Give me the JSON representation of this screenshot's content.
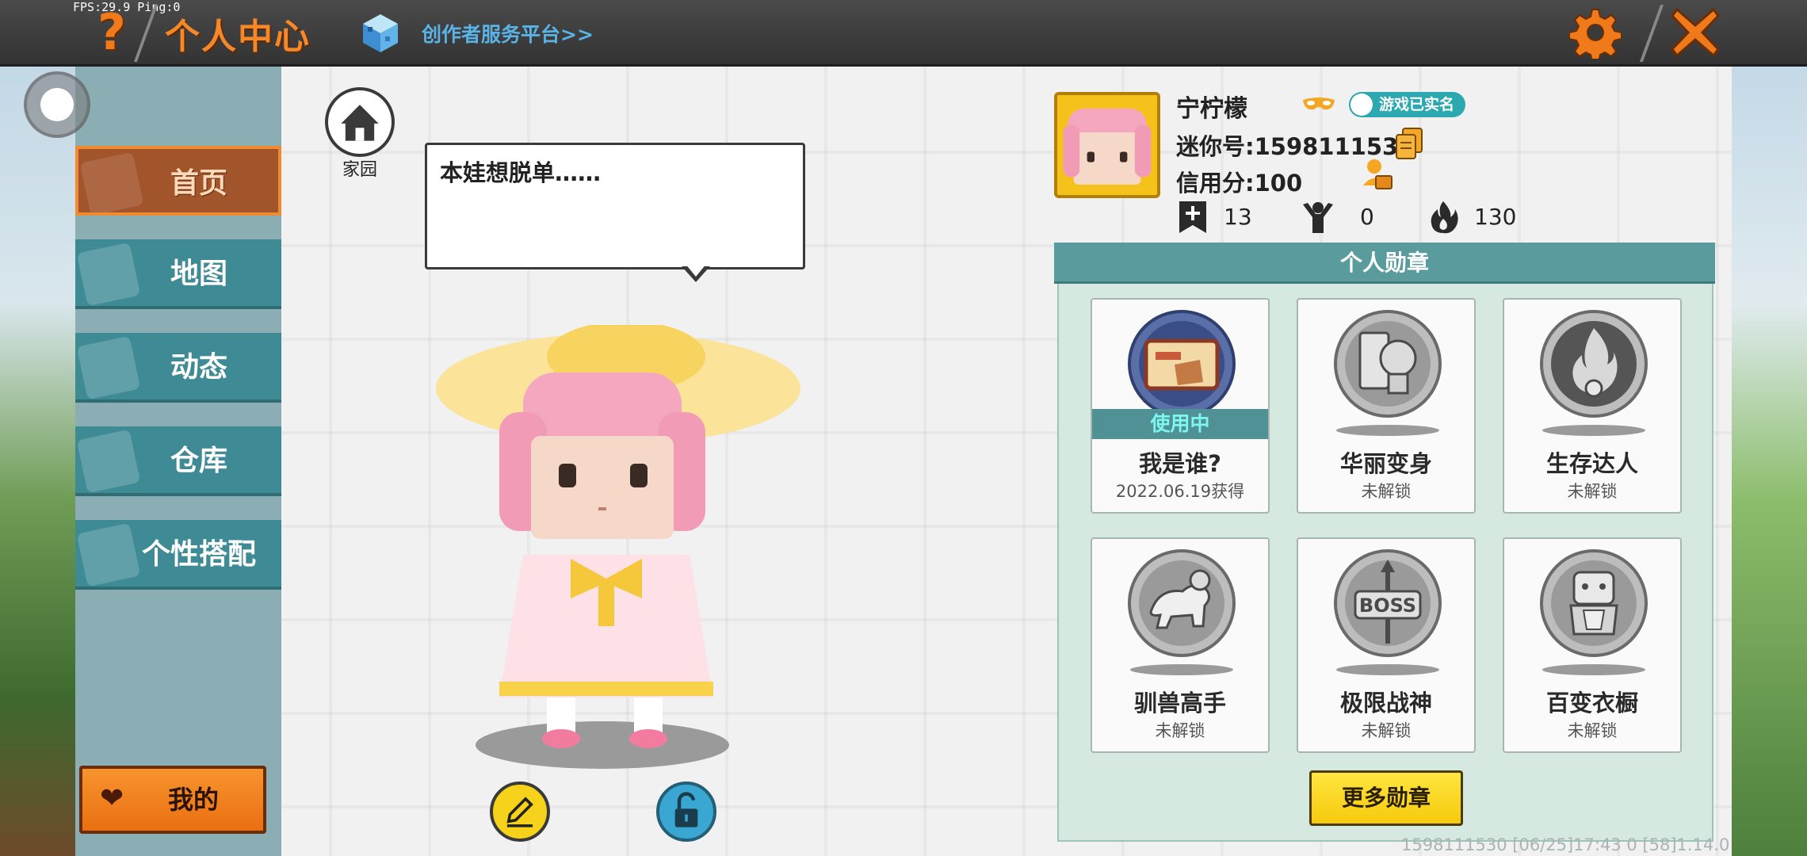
{
  "debug": {
    "fps_text": "FPS:29.9  Ping:0"
  },
  "header": {
    "help_symbol": "?",
    "title": "个人中心",
    "creator_link": "创作者服务平台>>"
  },
  "sidebar": {
    "items": [
      {
        "label": "首页",
        "active": true
      },
      {
        "label": "地图",
        "active": false
      },
      {
        "label": "动态",
        "active": false
      },
      {
        "label": "仓库",
        "active": false
      },
      {
        "label": "个性搭配",
        "active": false
      }
    ],
    "mine_label": "我的"
  },
  "stage": {
    "home_label": "家园",
    "speech": "本娃想脱单……"
  },
  "profile": {
    "nickname": "宁柠檬",
    "realname_badge": "游戏已实名",
    "mini_id": "迷你号:1598111530",
    "credit": "信用分:100",
    "stats": {
      "plus": "13",
      "fans": "0",
      "heat": "130"
    }
  },
  "medals": {
    "title": "个人勋章",
    "items": [
      {
        "name": "我是谁?",
        "status": "2022.06.19获得",
        "in_use": "使用中",
        "unlocked": true
      },
      {
        "name": "华丽变身",
        "status": "未解锁",
        "unlocked": false
      },
      {
        "name": "生存达人",
        "status": "未解锁",
        "unlocked": false
      },
      {
        "name": "驯兽高手",
        "status": "未解锁",
        "unlocked": false
      },
      {
        "name": "极限战神",
        "status": "未解锁",
        "unlocked": false
      },
      {
        "name": "百变衣橱",
        "status": "未解锁",
        "unlocked": false
      }
    ],
    "more_label": "更多勋章"
  },
  "footer": {
    "info": "1598111530    [06/25]17:43 0  [58]1.14.0"
  },
  "colors": {
    "accent_orange": "#f5892a",
    "sidebar_teal": "#3f8b95",
    "medal_header": "#5a9b9d",
    "button_yellow": "#f6c90c"
  }
}
